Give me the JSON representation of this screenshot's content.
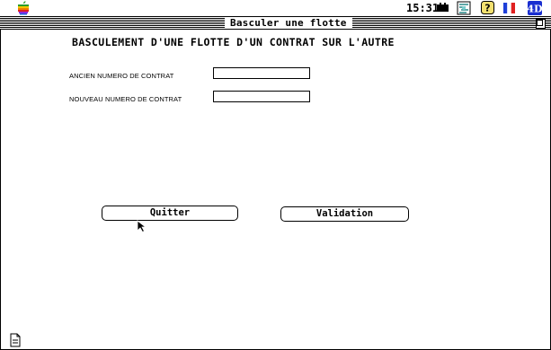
{
  "menubar": {
    "apple_icon": "apple-icon",
    "clock": "15:31",
    "icons": [
      "battery-icon",
      "network-icon",
      "help-icon",
      "flag-icon",
      "app-icon"
    ]
  },
  "window": {
    "title": "Basculer une flotte"
  },
  "form": {
    "heading": "BASCULEMENT D'UNE FLOTTE D'UN CONTRAT SUR L'AUTRE",
    "old_contract_label": "ANCIEN NUMERO DE CONTRAT",
    "old_contract_value": "",
    "new_contract_label": "NOUVEAU NUMERO DE CONTRAT",
    "new_contract_value": ""
  },
  "buttons": {
    "quit": "Quitter",
    "validate": "Validation"
  }
}
